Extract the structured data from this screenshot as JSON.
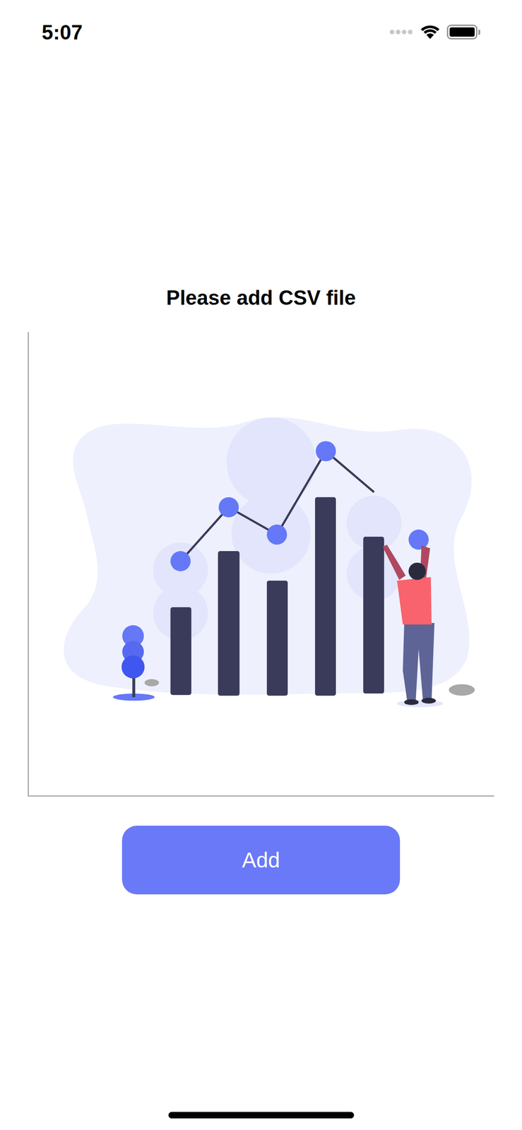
{
  "status_bar": {
    "time": "5:07",
    "battery_level": 1
  },
  "title": "Please add CSV file",
  "button": {
    "label": "Add"
  }
}
